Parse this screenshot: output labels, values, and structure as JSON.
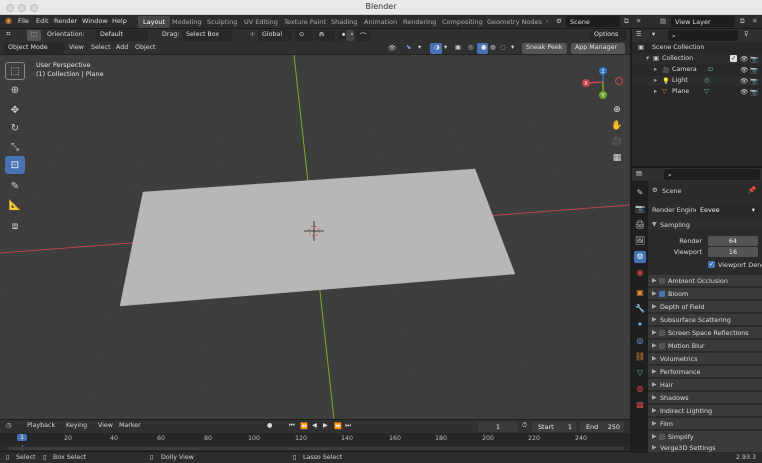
{
  "window": {
    "title": "Blender"
  },
  "menubar": {
    "items": [
      "File",
      "Edit",
      "Render",
      "Window",
      "Help"
    ],
    "workspaces": [
      "Layout",
      "Modeling",
      "Sculpting",
      "UV Editing",
      "Texture Paint",
      "Shading",
      "Animation",
      "Rendering",
      "Compositing",
      "Geometry Nodes"
    ],
    "active_workspace": "Layout",
    "scene": "Scene",
    "view_layer": "View Layer"
  },
  "vp_header1": {
    "orientation_label": "Orientation:",
    "orientation_value": "Default",
    "drag_label": "Drag:",
    "drag_value": "Select Box",
    "transform_value": "Global",
    "options_label": "Options"
  },
  "vp_header2": {
    "mode": "Object Mode",
    "menus": [
      "View",
      "Select",
      "Add",
      "Object"
    ],
    "sneak_peek": "Sneak Peek",
    "app_manager": "App Manager"
  },
  "viewport": {
    "perspective": "User Perspective",
    "collection_info": "(1) Collection | Plane",
    "gizmo": {
      "x": "X",
      "y": "Y",
      "z": "Z"
    },
    "colors": {
      "background": "#3d3d3d",
      "plane": "#b7b7b7",
      "x_axis": "#b8454f",
      "y_axis": "#7aa82b"
    }
  },
  "timeline": {
    "menus": [
      "Playback",
      "Keying",
      "View",
      "Marker"
    ],
    "current_frame": "1",
    "start_label": "Start",
    "start_value": "1",
    "end_label": "End",
    "end_value": "250",
    "ruler": [
      "1",
      "20",
      "40",
      "60",
      "80",
      "100",
      "120",
      "140",
      "160",
      "180",
      "200",
      "220",
      "240"
    ]
  },
  "statusbar": {
    "select": "Select",
    "box_select": "Box Select",
    "dolly_view": "Dolly View",
    "lasso_select": "Lasso Select",
    "version": "2.93.3"
  },
  "outliner": {
    "title": "Scene Collection",
    "rows": [
      {
        "label": "Collection"
      },
      {
        "label": "Camera"
      },
      {
        "label": "Light"
      },
      {
        "label": "Plane"
      }
    ]
  },
  "properties": {
    "context": "Scene",
    "render_engine_label": "Render Engine",
    "render_engine": "Eevee",
    "sampling": {
      "title": "Sampling",
      "render_label": "Render",
      "render_value": "64",
      "viewport_label": "Viewport",
      "viewport_value": "16",
      "denoise_label": "Viewport Denois..."
    },
    "panels": [
      {
        "label": "Ambient Occlusion",
        "checkbox": true,
        "checked": false
      },
      {
        "label": "Bloom",
        "checkbox": true,
        "checked": true
      },
      {
        "label": "Depth of Field",
        "checkbox": false,
        "checked": false
      },
      {
        "label": "Subsurface Scattering",
        "checkbox": false,
        "checked": false
      },
      {
        "label": "Screen Space Reflections",
        "checkbox": true,
        "checked": false
      },
      {
        "label": "Motion Blur",
        "checkbox": true,
        "checked": false
      },
      {
        "label": "Volumetrics",
        "checkbox": false,
        "checked": false
      },
      {
        "label": "Performance",
        "checkbox": false,
        "checked": false
      },
      {
        "label": "Hair",
        "checkbox": false,
        "checked": false
      },
      {
        "label": "Shadows",
        "checkbox": false,
        "checked": false
      },
      {
        "label": "Indirect Lighting",
        "checkbox": false,
        "checked": false
      },
      {
        "label": "Film",
        "checkbox": false,
        "checked": false
      },
      {
        "label": "Simplify",
        "checkbox": true,
        "checked": false
      },
      {
        "label": "Verge3D Settings",
        "checkbox": false,
        "checked": false
      }
    ]
  }
}
